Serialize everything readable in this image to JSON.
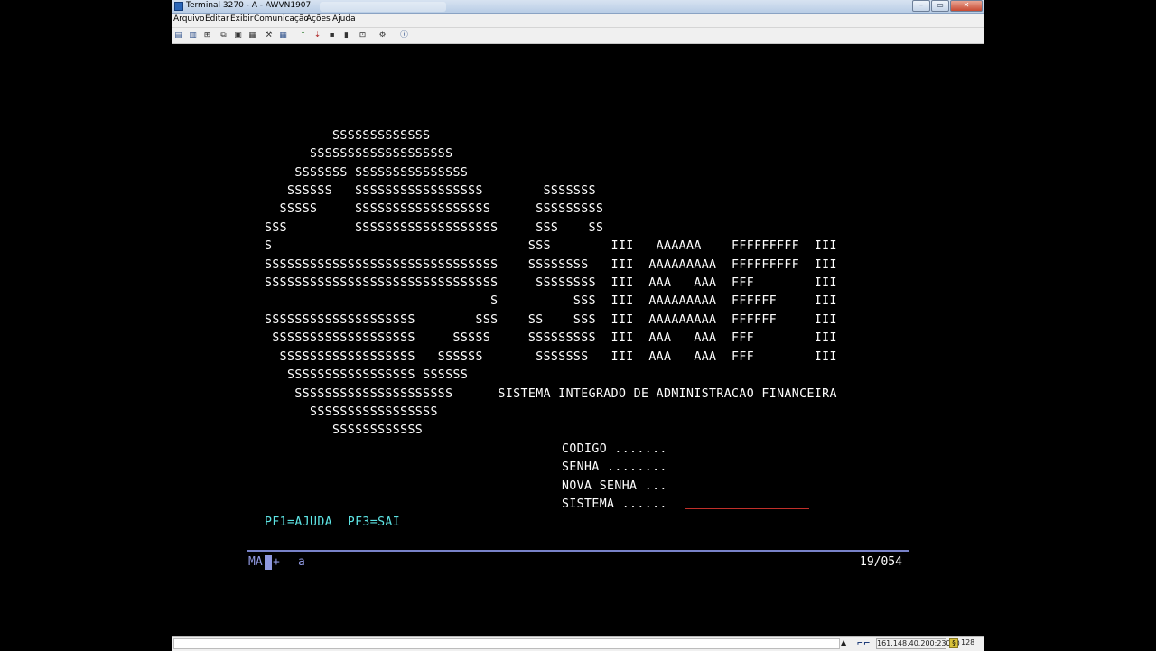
{
  "window": {
    "title": "Terminal 3270 - A - AWVN1907",
    "buttons": {
      "minimize": "–",
      "restore": "▭",
      "close": "✕"
    }
  },
  "menu": [
    "Arquivo",
    "Editar",
    "Exibir",
    "Comunicação",
    "Ações",
    "Ajuda"
  ],
  "toolbar_icons": [
    "print-icon",
    "print-screen-icon",
    "page-setup-icon",
    "copy-icon",
    "paste-icon",
    "paste-next-icon",
    "keymap-icon",
    "grid-icon",
    "send-file-icon",
    "receive-file-icon",
    "macro-record-icon",
    "macro-play-icon",
    "macro-stop-icon",
    "settings-icon",
    "help-icon"
  ],
  "screen": {
    "logo_lines": [
      "         SSSSSSSSSSSSS",
      "      SSSSSSSSSSSSSSSSSSS",
      "    SSSSSSS SSSSSSSSSSSSSSS",
      "   SSSSSS   SSSSSSSSSSSSSSSSS        SSSSSSS",
      "  SSSSS     SSSSSSSSSSSSSSSSSS      SSSSSSSSS",
      "SSS         SSSSSSSSSSSSSSSSSSS     SSS    SS",
      "S                                  SSS        III   AAAAAA    FFFFFFFFF  III",
      "SSSSSSSSSSSSSSSSSSSSSSSSSSSSSSS    SSSSSSSS   III  AAAAAAAAA  FFFFFFFFF  III",
      "SSSSSSSSSSSSSSSSSSSSSSSSSSSSSSS     SSSSSSSS  III  AAA   AAA  FFF        III",
      "                              S          SSS  III  AAAAAAAAA  FFFFFF     III",
      "SSSSSSSSSSSSSSSSSSSS        SSS    SS    SSS  III  AAAAAAAAA  FFFFFF     III",
      " SSSSSSSSSSSSSSSSSSS     SSSSS     SSSSSSSSS  III  AAA   AAA  FFF        III",
      "  SSSSSSSSSSSSSSSSSS   SSSSSS       SSSSSSS   III  AAA   AAA  FFF        III",
      "   SSSSSSSSSSSSSSSSS SSSSSS",
      "    SSSSSSSSSSSSSSSSSSSSS      SISTEMA INTEGRADO DE ADMINISTRACAO FINANCEIRA",
      "      SSSSSSSSSSSSSSSSS",
      "         SSSSSSSSSSSS"
    ],
    "fields": {
      "codigo": "CODIGO .......",
      "senha": "SENHA ........",
      "nova_senha": "NOVA SENHA ...",
      "sistema": "SISTEMA ......"
    },
    "pf_keys": "PF1=AJUDA  PF3=SAI"
  },
  "oia": {
    "mode": "MA",
    "plus": "+",
    "char": "a",
    "cursor_position": "19/054"
  },
  "statusbar": {
    "arrow": "▲",
    "host": "161.148.40.200:23000",
    "count": "128"
  }
}
